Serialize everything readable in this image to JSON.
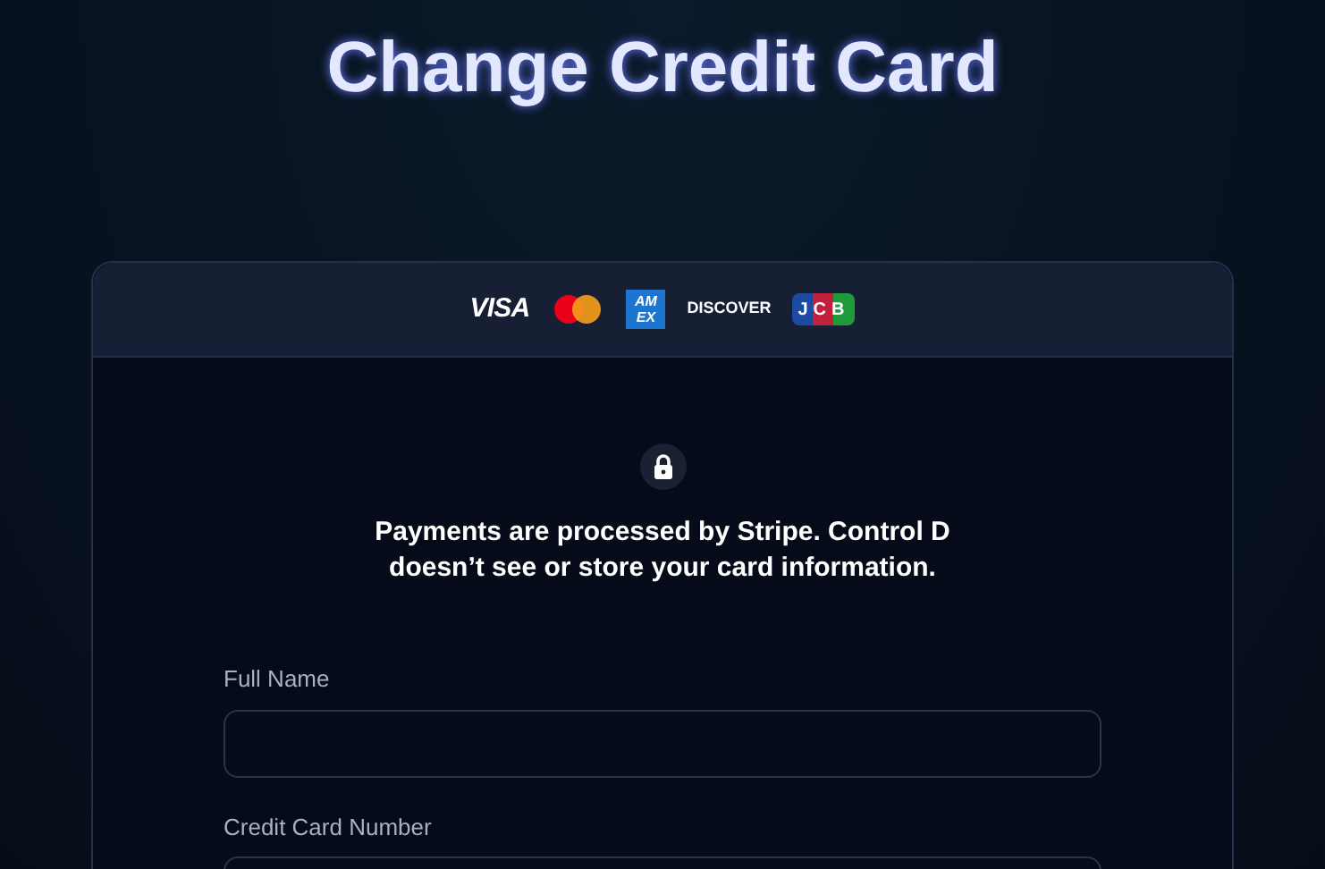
{
  "title": "Change Credit Card",
  "card_brands": [
    {
      "kind": "visa",
      "label": "VISA"
    },
    {
      "kind": "mastercard"
    },
    {
      "kind": "amex",
      "label": "AM EX"
    },
    {
      "kind": "discover",
      "label": "DISCOVER"
    },
    {
      "kind": "jcb",
      "label": "JCB"
    }
  ],
  "notice": "Payments are processed by Stripe. Control D doesn’t see or store your card information.",
  "fields": [
    {
      "label": "Full Name"
    },
    {
      "label": "Credit Card Number"
    }
  ]
}
